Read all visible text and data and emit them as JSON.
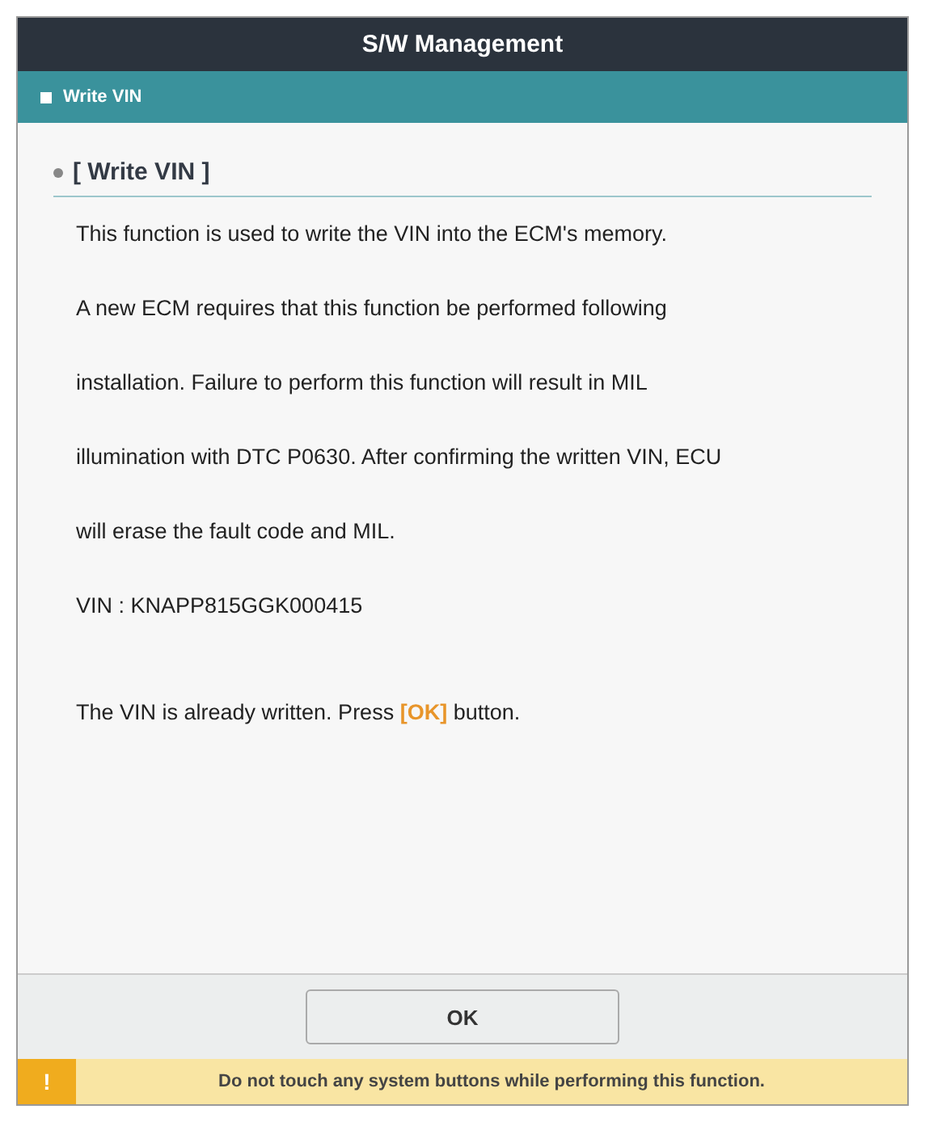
{
  "window": {
    "title": "S/W Management"
  },
  "section_bar": {
    "label": "Write VIN"
  },
  "heading": "[ Write VIN ]",
  "paragraphs": [
    "This function is used to write the VIN into the ECM's memory.",
    "A new ECM requires that this function be performed following installation. Failure to perform this function will result in MIL illumination with DTC P0630. After confirming the written VIN, ECU will erase the fault code and MIL."
  ],
  "vin_line": "VIN : KNAPP815GGK000415",
  "notice": "The VIN is already written. Press **[OK]** button.",
  "buttons": [
    "OK"
  ],
  "warning": {
    "icon": "!",
    "text": "Do not touch any system buttons while performing this function."
  }
}
